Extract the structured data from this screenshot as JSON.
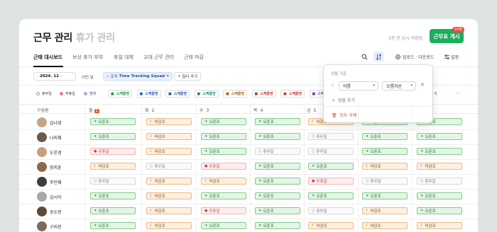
{
  "header": {
    "title": "근무 관리",
    "subtitle": "휴가 관리",
    "saved_text": "2분 전 임시 저장됨",
    "publish_label": "근무표 게시",
    "publish_badge": "10명"
  },
  "tabs": [
    "근태 대시보드",
    "보상 휴가 부여",
    "휴일 대체",
    "교대 근무 관리",
    "근태 마감"
  ],
  "toolbar": {
    "upload_download": "업로드 · 다운로드",
    "settings": "설정"
  },
  "filters": {
    "date": "2024. 12",
    "prev_month": "이번 달",
    "org_prefix": "조직",
    "org_value": "Time Tracking Squad",
    "add_filter": "필터 추가"
  },
  "legend": {
    "items": [
      {
        "label": "휴무일",
        "color": "#ffffff"
      },
      {
        "label": "주휴일",
        "color": "#f07a7a"
      },
      {
        "label": "연차",
        "color": "#8db4f0"
      }
    ],
    "schedules": [
      {
        "label": "스케줄명",
        "color": "#1f9a4a"
      },
      {
        "label": "스케줄명",
        "color": "#2a5fb8"
      },
      {
        "label": "스케줄명",
        "color": "#2a5fb8"
      },
      {
        "label": "스케줄명",
        "color": "#1b8c80"
      },
      {
        "label": "스케줄명",
        "color": "#a4631c"
      },
      {
        "label": "스케줄명",
        "color": "#c0392b"
      },
      {
        "label": "스케줄명",
        "color": "#c0392b"
      },
      {
        "label": "스케줄명",
        "color": "#7a3fa0"
      }
    ],
    "overflow": "기"
  },
  "table": {
    "member_header": "구성원",
    "days": [
      {
        "label": "월",
        "num": "1",
        "today": true
      },
      {
        "label": "화",
        "num": "2",
        "today": false
      },
      {
        "label": "수",
        "num": "3",
        "today": false
      },
      {
        "label": "목",
        "num": "4",
        "today": false
      },
      {
        "label": "금",
        "num": "5",
        "today": false
      },
      {
        "label": "",
        "num": "",
        "today": false
      },
      {
        "label": "",
        "num": "",
        "today": false
      }
    ],
    "rows": [
      {
        "name": "김나영",
        "avatar": "#c4a58a",
        "cells": [
          "g",
          "o",
          "g",
          "g",
          "o",
          "g",
          "g"
        ]
      },
      {
        "name": "나지혜",
        "avatar": "#6b5a4a",
        "cells": [
          "g",
          "o",
          "g",
          "g",
          "h",
          "g",
          "g"
        ]
      },
      {
        "name": "도운경",
        "avatar": "#c9a07c",
        "cells": [
          "r",
          "o",
          "g",
          "h",
          "h",
          "g",
          "g"
        ]
      },
      {
        "name": "장지훈",
        "avatar": "#8b6a4e",
        "cells": [
          "o",
          "h",
          "r",
          "g",
          "g",
          "o",
          "o"
        ]
      },
      {
        "name": "주인혜",
        "avatar": "#3d3d3d",
        "cells": [
          "h",
          "o",
          "o",
          "g",
          "r",
          "h",
          "h"
        ]
      },
      {
        "name": "김시아",
        "avatar": "#a9a9a9",
        "cells": [
          "g",
          "o",
          "g",
          "g",
          "g",
          "g",
          "g"
        ]
      },
      {
        "name": "송도현",
        "avatar": "#5e4a3a",
        "cells": [
          "g",
          "o",
          "r",
          "g",
          "h",
          "o",
          "g"
        ]
      },
      {
        "name": "구지현",
        "avatar": "#7a6b5c",
        "cells": [
          "g",
          "o",
          "g",
          "g",
          "o",
          "o",
          "o"
        ]
      }
    ],
    "cell_labels": {
      "g": "오픈조",
      "o": "마감조",
      "h": "휴무일",
      "r": "주휴일"
    }
  },
  "sort_popover": {
    "label": "정렬 기준",
    "field": "이름",
    "order": "오름차순",
    "add_label": "정렬 추가",
    "delete_label": "모두 삭제"
  }
}
